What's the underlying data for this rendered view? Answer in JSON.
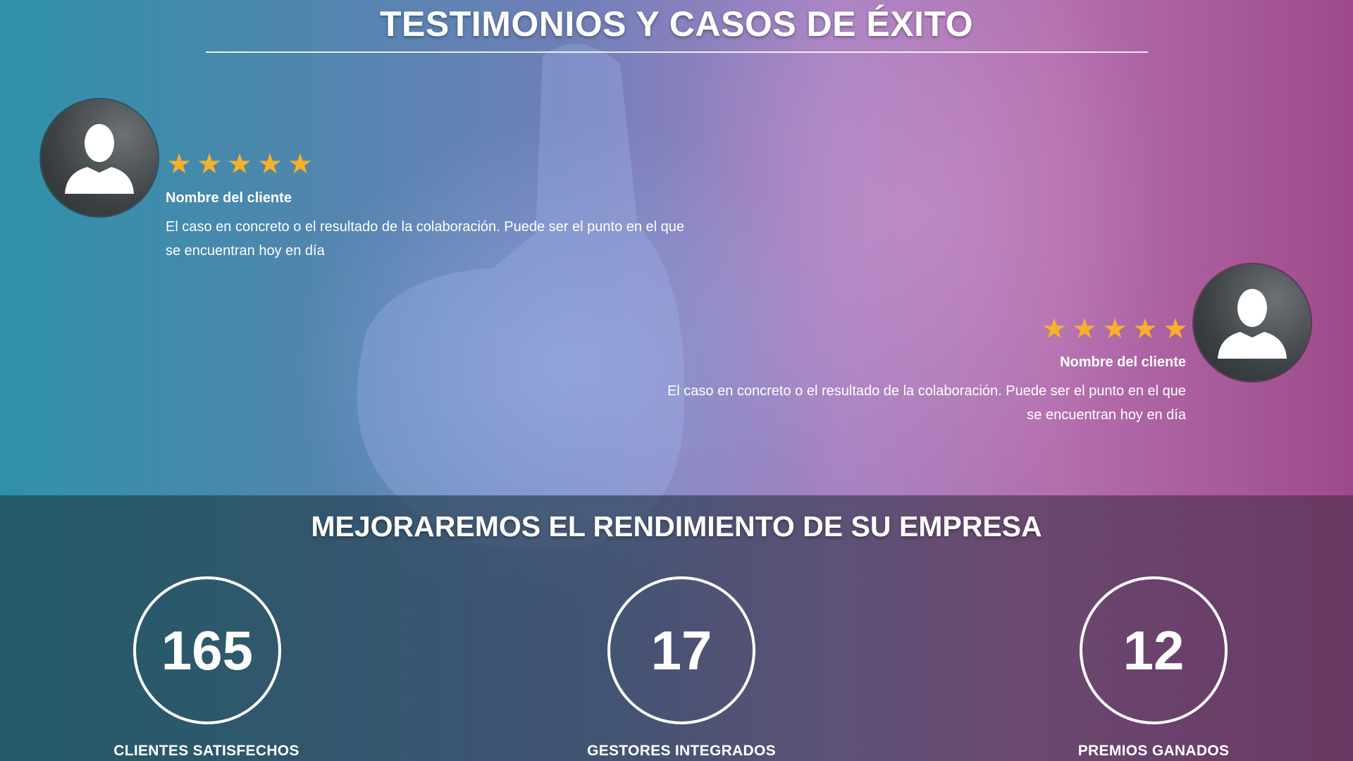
{
  "testimonials": {
    "title": "TESTIMONIOS Y CASOS DE ÉXITO",
    "items": [
      {
        "rating": 5,
        "stars": "★★★★★",
        "name": "Nombre del cliente",
        "text": "El caso en concreto o el resultado de la colaboración. Puede ser el punto en el que se encuentran hoy en día",
        "icon": "user-silhouette-icon"
      },
      {
        "rating": 5,
        "stars": "★★★★★",
        "name": "Nombre del cliente",
        "text": "El caso en concreto o el resultado de la colaboración. Puede ser el punto en el que se encuentran hoy en día",
        "icon": "user-silhouette-icon"
      }
    ]
  },
  "stats": {
    "title": "MEJORAREMOS EL RENDIMIENTO DE SU EMPRESA",
    "items": [
      {
        "value": "165",
        "label": "CLIENTES SATISFECHOS"
      },
      {
        "value": "17",
        "label": "GESTORES INTEGRADOS"
      },
      {
        "value": "12",
        "label": "PREMIOS GANADOS"
      }
    ]
  },
  "colors": {
    "star": "#f6b02a",
    "gradient_left": "#2f91a8",
    "gradient_right": "#9e4a8a"
  }
}
